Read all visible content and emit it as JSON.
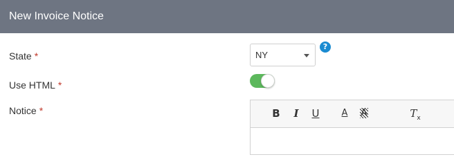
{
  "header": {
    "title": "New Invoice Notice"
  },
  "form": {
    "state": {
      "label": "State",
      "required_mark": "*",
      "value": "NY",
      "help_glyph": "?"
    },
    "use_html": {
      "label": "Use HTML",
      "required_mark": "*",
      "enabled": true
    },
    "notice": {
      "label": "Notice",
      "required_mark": "*"
    }
  },
  "editor_toolbar": {
    "bold": "B",
    "italic": "I",
    "underline": "U",
    "text_color": "A",
    "background_color": "A",
    "clear_format": "T",
    "clear_format_sub": "x"
  },
  "colors": {
    "header_bg": "#6e7582",
    "required": "#c0392b",
    "toggle_on": "#5cb85c",
    "help": "#1a8bd1"
  }
}
